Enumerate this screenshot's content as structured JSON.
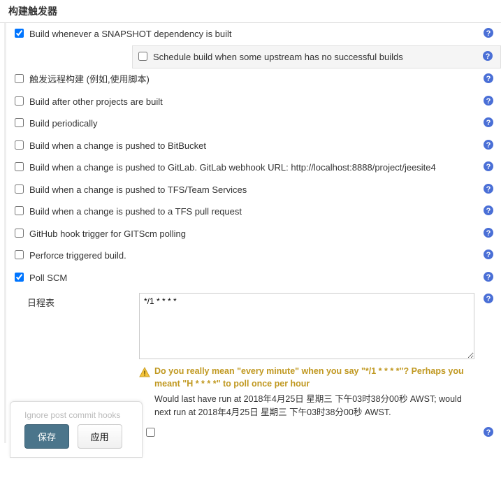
{
  "section": {
    "title": "构建触发器"
  },
  "triggers": {
    "snapshot": {
      "checked": true,
      "label": "Build whenever a SNAPSHOT dependency is built"
    },
    "schedule_upstream": {
      "checked": false,
      "label": "Schedule build when some upstream has no successful builds"
    },
    "remote": {
      "checked": false,
      "label": "触发远程构建 (例如,使用脚本)"
    },
    "after": {
      "checked": false,
      "label": "Build after other projects are built"
    },
    "periodic": {
      "checked": false,
      "label": "Build periodically"
    },
    "bitbucket": {
      "checked": false,
      "label": "Build when a change is pushed to BitBucket"
    },
    "gitlab": {
      "checked": false,
      "label": "Build when a change is pushed to GitLab. GitLab webhook URL: http://localhost:8888/project/jeesite4"
    },
    "tfs": {
      "checked": false,
      "label": "Build when a change is pushed to TFS/Team Services"
    },
    "tfspr": {
      "checked": false,
      "label": "Build when a change is pushed to a TFS pull request"
    },
    "github": {
      "checked": false,
      "label": "GitHub hook trigger for GITScm polling"
    },
    "perforce": {
      "checked": false,
      "label": "Perforce triggered build."
    },
    "pollscm": {
      "checked": true,
      "label": "Poll SCM"
    }
  },
  "schedule": {
    "label": "日程表",
    "value": "*/1 * * * *",
    "warning": "Do you really mean \"every minute\" when you say \"*/1 * * * *\"? Perhaps you meant \"H * * * *\" to poll once per hour",
    "detail": "Would last have run at 2018年4月25日 星期三 下午03时38分00秒 AWST; would next run at 2018年4月25日 星期三 下午03时38分00秒 AWST."
  },
  "ignore_hooks": {
    "checked": false
  },
  "footer": {
    "ghost": "Ignore post commit hooks",
    "save": "保存",
    "apply": "应用"
  }
}
